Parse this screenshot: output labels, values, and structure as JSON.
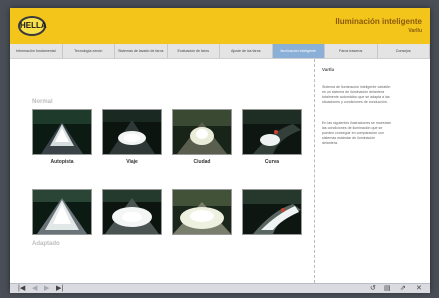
{
  "header": {
    "title": "Iluminación inteligente",
    "subtitle": "VarIlu",
    "logo_text": "HELLA"
  },
  "nav": {
    "tabs": [
      {
        "label": "Información fundamental",
        "active": false
      },
      {
        "label": "Tecnología xenón",
        "active": false
      },
      {
        "label": "Sistemas de lavado de faros",
        "active": false
      },
      {
        "label": "Evaluación de faros",
        "active": false
      },
      {
        "label": "Ajuste de los faros",
        "active": false
      },
      {
        "label": "Iluminación inteligente",
        "active": true
      },
      {
        "label": "Faros traseros",
        "active": false
      },
      {
        "label": "Consejos",
        "active": false
      }
    ]
  },
  "main": {
    "row_normal_label": "Normal",
    "row_adaptive_label": "Adaptado",
    "captions": [
      "Autopista",
      "Viaje",
      "Ciudad",
      "Curva"
    ]
  },
  "side": {
    "title": "VarIlu",
    "para1": "Sistema de iluminación inteligente variable: es un sistema de iluminación delantera totalmente automático que se adapta a las situaciones y condiciones de conducción.",
    "para2": "En las siguientes ilustraciones se muestran las condiciones de iluminación que se pueden conseguir en comparación con sistemas estándar de iluminación delantera."
  },
  "footer": {
    "first": "|◀",
    "prev": "◀",
    "next": "▶",
    "last": "▶|",
    "reload": "↺",
    "print": "▤",
    "export": "⇗",
    "close": "✕"
  },
  "colors": {
    "header_bg": "#f3c51b",
    "active_tab": "#8ab0d8"
  }
}
